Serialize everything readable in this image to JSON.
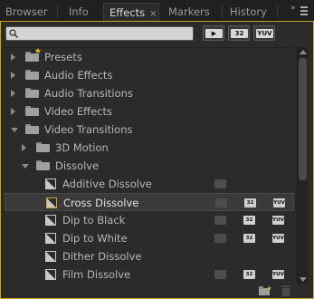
{
  "tabs": [
    {
      "label": "Browser",
      "active": false
    },
    {
      "label": "Info",
      "active": false
    },
    {
      "label": "Effects",
      "active": true
    },
    {
      "label": "Markers",
      "active": false
    },
    {
      "label": "History",
      "active": false
    }
  ],
  "tab_close_glyph": "×",
  "menu_glyph": "»",
  "search": {
    "value": "",
    "placeholder": ""
  },
  "filter_buttons": [
    {
      "icon": "accelerated-effects-icon",
      "label": "▶"
    },
    {
      "icon": "32-bit-icon",
      "label": "32"
    },
    {
      "icon": "yuv-icon",
      "label": "YUV"
    }
  ],
  "tree": [
    {
      "label": "Presets",
      "type": "folder",
      "expanded": false,
      "depth": 0,
      "star": true
    },
    {
      "label": "Audio Effects",
      "type": "folder",
      "expanded": false,
      "depth": 0
    },
    {
      "label": "Audio Transitions",
      "type": "folder",
      "expanded": false,
      "depth": 0
    },
    {
      "label": "Video Effects",
      "type": "folder",
      "expanded": false,
      "depth": 0
    },
    {
      "label": "Video Transitions",
      "type": "folder",
      "expanded": true,
      "depth": 0
    },
    {
      "label": "3D Motion",
      "type": "folder",
      "expanded": false,
      "depth": 1
    },
    {
      "label": "Dissolve",
      "type": "folder",
      "expanded": true,
      "depth": 1
    },
    {
      "label": "Additive Dissolve",
      "type": "effect",
      "depth": 2,
      "badges": [
        "accel",
        "none",
        "none"
      ]
    },
    {
      "label": "Cross Dissolve",
      "type": "effect",
      "depth": 2,
      "selected": true,
      "badges": [
        "accel",
        "on",
        "on"
      ]
    },
    {
      "label": "Dip to Black",
      "type": "effect",
      "depth": 2,
      "badges": [
        "accel",
        "on",
        "on"
      ]
    },
    {
      "label": "Dip to White",
      "type": "effect",
      "depth": 2,
      "badges": [
        "accel",
        "on",
        "on"
      ]
    },
    {
      "label": "Dither Dissolve",
      "type": "effect",
      "depth": 2,
      "badges": [
        "none",
        "none",
        "none"
      ]
    },
    {
      "label": "Film Dissolve",
      "type": "effect",
      "depth": 2,
      "badges": [
        "accel",
        "on",
        "on"
      ]
    }
  ],
  "footer": {
    "new_bin_icon": "new-custom-bin-icon",
    "delete_icon": "trash-icon"
  },
  "colors": {
    "accent": "#c9a227",
    "panel": "#2b2b2b",
    "text": "#b8b8b8",
    "star": "#f0c020"
  }
}
